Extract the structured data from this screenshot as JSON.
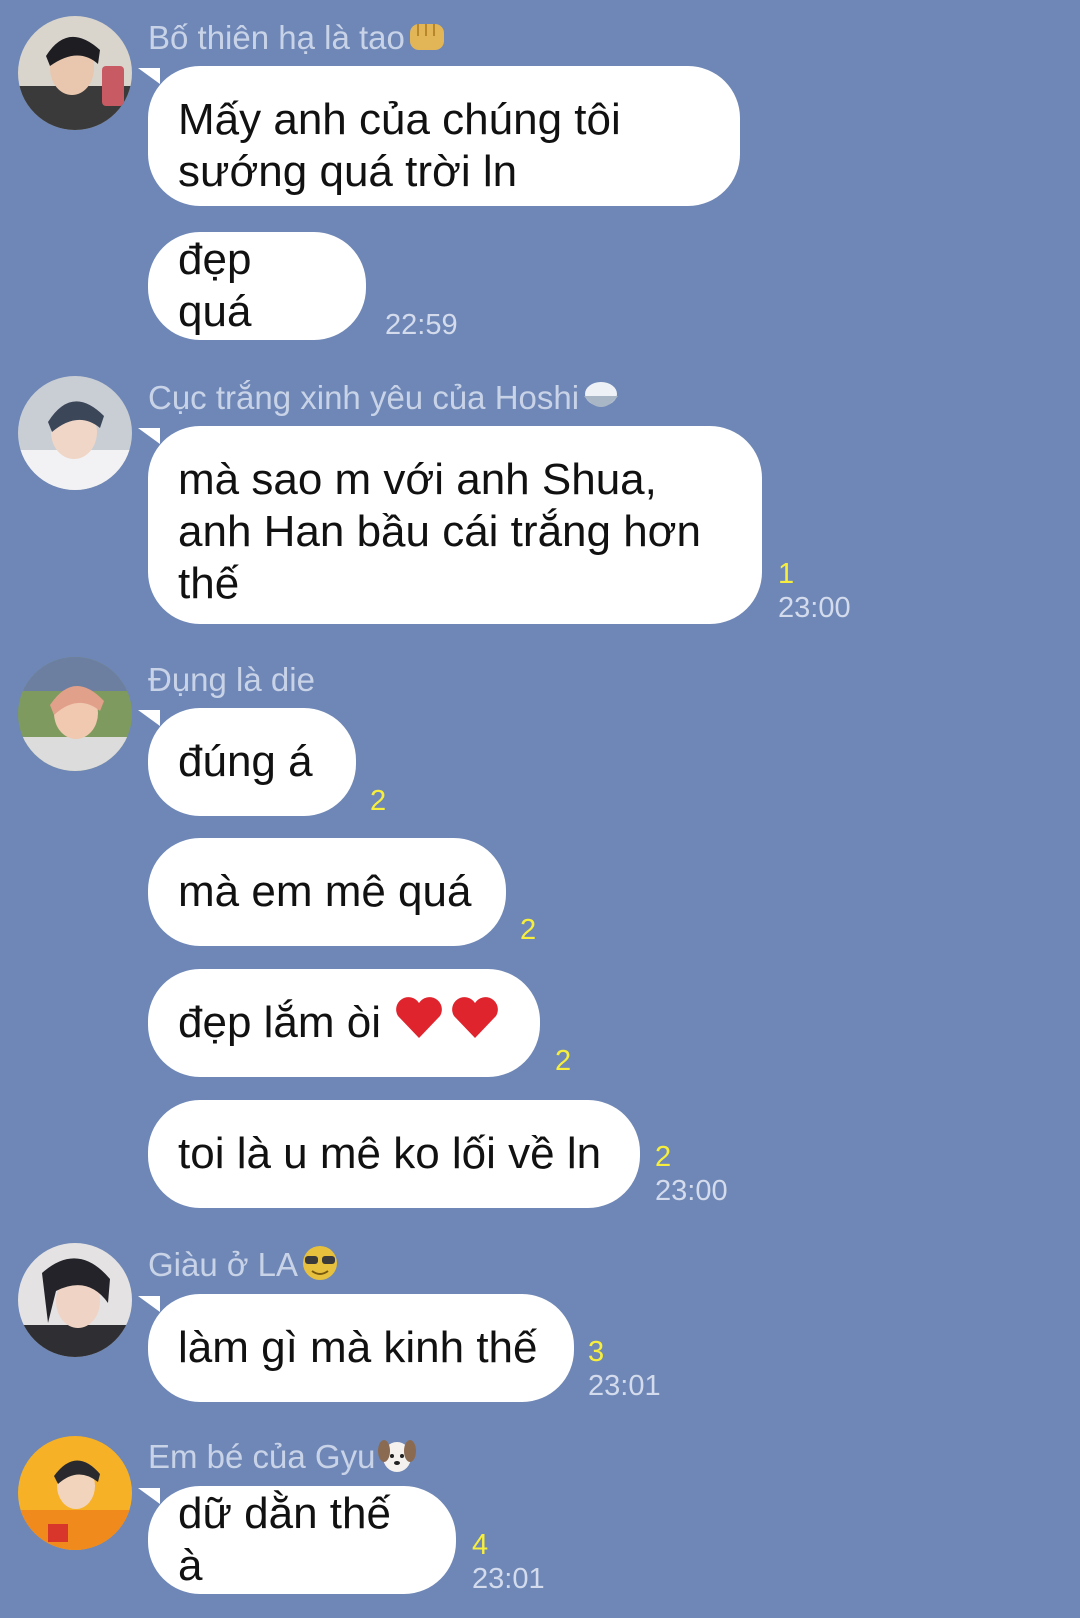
{
  "theme": {
    "background": "#6e87b6",
    "bubble": "#ffffff",
    "sender_color": "#c9d3e8",
    "time_color": "#d3dbec",
    "read_count_color": "#f7ef3c"
  },
  "groups": [
    {
      "sender": "Bố thiên hạ là tao",
      "sender_emoji": "fist-emoji",
      "messages": [
        {
          "text": "Mấy anh của chúng tôi sướng quá trời ln"
        },
        {
          "text": "đẹp quá",
          "time": "22:59"
        }
      ]
    },
    {
      "sender": "Cục trắng xinh yêu của Hoshi",
      "sender_emoji": "rice-bowl-emoji",
      "messages": [
        {
          "text": "mà sao m với anh Shua, anh Han bầu cái trắng hơn thế",
          "read_count": "1",
          "time": "23:00"
        }
      ]
    },
    {
      "sender": "Đụng là die",
      "messages": [
        {
          "text": "đúng á",
          "read_count": "2"
        },
        {
          "text": "mà em mê quá",
          "read_count": "2"
        },
        {
          "text": "đẹp lắm òi",
          "trailing_emoji": "red-heart-emoji x2",
          "read_count": "2"
        },
        {
          "text": "toi là u mê ko lối về ln",
          "read_count": "2",
          "time": "23:00"
        }
      ]
    },
    {
      "sender": "Giàu ở LA",
      "sender_emoji": "sunglasses-emoji",
      "messages": [
        {
          "text": "làm gì mà kinh thế",
          "read_count": "3",
          "time": "23:01"
        }
      ]
    },
    {
      "sender": "Em bé của Gyu",
      "sender_emoji": "dog-face-emoji",
      "messages": [
        {
          "text": "dữ dằn thế à",
          "read_count": "4",
          "time": "23:01"
        }
      ]
    }
  ]
}
